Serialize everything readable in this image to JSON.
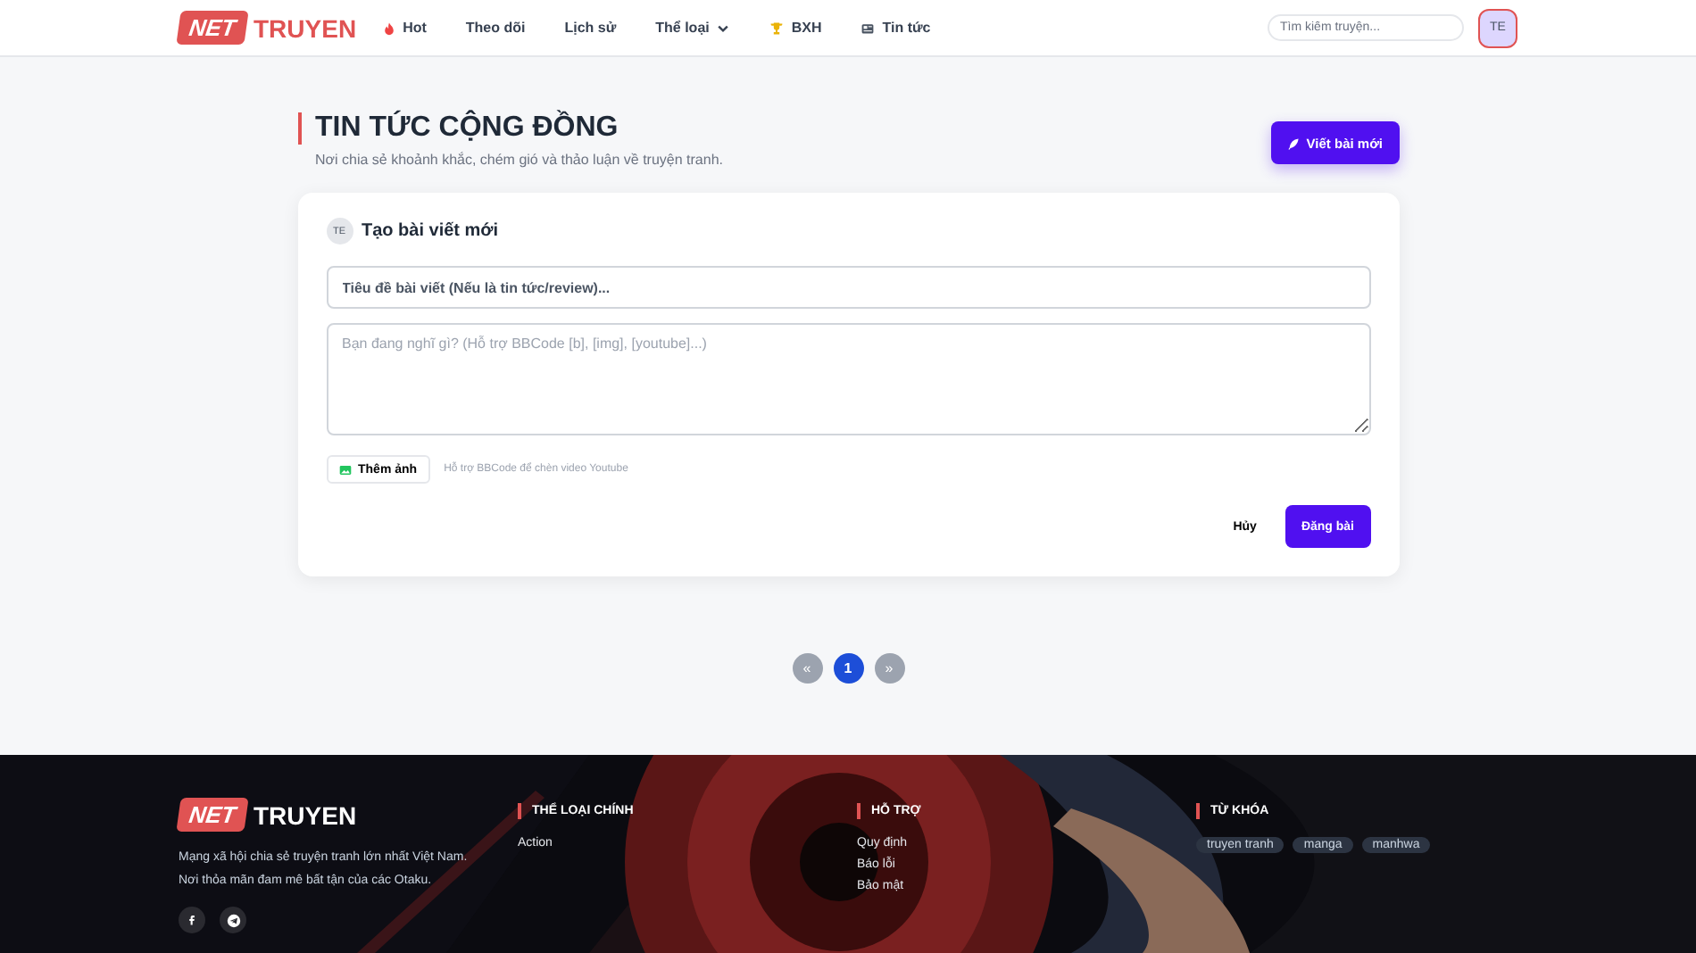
{
  "header": {
    "logo": {
      "badge": "NET",
      "text": "TRUYEN"
    },
    "nav": [
      {
        "label": "Hot"
      },
      {
        "label": "Theo dõi"
      },
      {
        "label": "Lịch sử"
      },
      {
        "label": "Thể loại"
      },
      {
        "label": "BXH"
      },
      {
        "label": "Tin tức"
      }
    ],
    "search": {
      "placeholder": "Tìm kiếm truyện..."
    },
    "avatar": "TE"
  },
  "page": {
    "title": "TIN TỨC CỘNG ĐỒNG",
    "subtitle": "Nơi chia sẻ khoảnh khắc, chém gió và thảo luận về truyện tranh.",
    "write_button": "Viết bài mới"
  },
  "composer": {
    "avatar": "TE",
    "heading": "Tạo bài viết mới",
    "title_field": {
      "placeholder": "Tiêu đề bài viết (Nếu là tin tức/review)..."
    },
    "body_field": {
      "placeholder": "Bạn đang nghĩ gì? (Hỗ trợ BBCode [b], [img], [youtube]...)"
    },
    "add_image": "Thêm ảnh",
    "hint": "Hỗ trợ BBCode để chèn video Youtube",
    "cancel": "Hủy",
    "submit": "Đăng bài"
  },
  "pagination": [
    {
      "label": "«",
      "selected": false
    },
    {
      "label": "1",
      "selected": true
    },
    {
      "label": "»",
      "selected": false
    }
  ],
  "footer": {
    "logo": {
      "badge": "NET",
      "text": "TRUYEN"
    },
    "about": [
      "Mạng xã hội chia sẻ truyện tranh lớn nhất Việt Nam.",
      "Nơi thỏa mãn đam mê bất tận của các Otaku."
    ],
    "socials": [
      {
        "kind": "facebook"
      },
      {
        "kind": "telegram"
      }
    ],
    "columns": [
      {
        "title": "THỂ LOẠI CHÍNH",
        "links": [
          "Action"
        ]
      },
      {
        "title": "HỖ TRỢ",
        "links": [
          "Quy định",
          "Báo lỗi",
          "Bảo mật"
        ]
      }
    ],
    "keywords": {
      "title": "TỪ KHÓA",
      "tags": [
        "truyen tranh",
        "manga",
        "manhwa"
      ]
    }
  }
}
